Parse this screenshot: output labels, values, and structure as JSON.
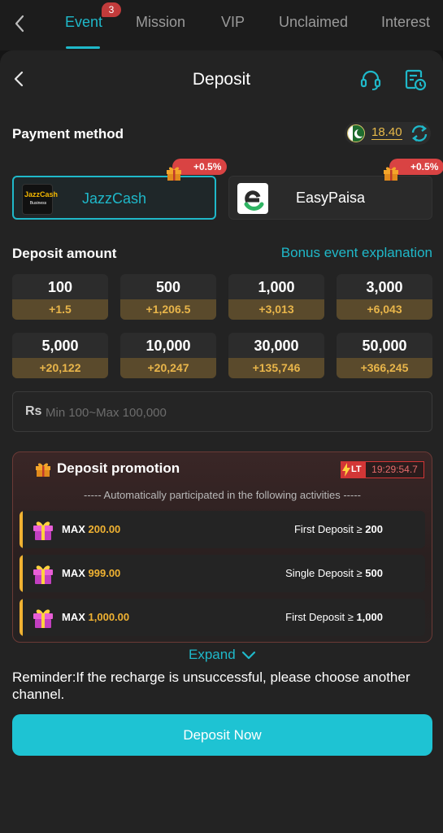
{
  "top_tabs": [
    {
      "label": "Event",
      "active": true,
      "badge": "3"
    },
    {
      "label": "Mission",
      "active": false
    },
    {
      "label": "VIP",
      "active": false
    },
    {
      "label": "Unclaimed",
      "active": false
    },
    {
      "label": "Interest",
      "active": false
    }
  ],
  "header": {
    "title": "Deposit",
    "icons": [
      "back-icon",
      "customer-service-icon",
      "deposit-history-icon"
    ]
  },
  "payment": {
    "label": "Payment method",
    "balance": "18.40",
    "balance_flag": "pakistan-flag-icon",
    "methods": [
      {
        "name": "JazzCash",
        "logo_text": "JazzCash",
        "logo_sub": "Business",
        "bonus": "+0.5%",
        "selected": true
      },
      {
        "name": "EasyPaisa",
        "bonus": "+0.5%",
        "selected": false
      }
    ]
  },
  "deposit_amount": {
    "label": "Deposit amount",
    "link": "Bonus event explanation",
    "options": [
      {
        "amount": "100",
        "bonus": "+1.5"
      },
      {
        "amount": "500",
        "bonus": "+1,206.5"
      },
      {
        "amount": "1,000",
        "bonus": "+3,013"
      },
      {
        "amount": "3,000",
        "bonus": "+6,043"
      },
      {
        "amount": "5,000",
        "bonus": "+20,122"
      },
      {
        "amount": "10,000",
        "bonus": "+20,247"
      },
      {
        "amount": "30,000",
        "bonus": "+135,746"
      },
      {
        "amount": "50,000",
        "bonus": "+366,245"
      }
    ],
    "currency": "Rs",
    "placeholder": "Min 100~Max 100,000"
  },
  "promotion": {
    "title": "Deposit promotion",
    "timer_tag": "LT",
    "timer": "19:29:54.7",
    "note": "----- Automatically participated in the following activities -----",
    "items": [
      {
        "max_label": "MAX",
        "max_value": "200.00",
        "condition": "First Deposit ≥ ",
        "threshold": "200"
      },
      {
        "max_label": "MAX",
        "max_value": "999.00",
        "condition": "Single Deposit ≥ ",
        "threshold": "500"
      },
      {
        "max_label": "MAX",
        "max_value": "1,000.00",
        "condition": "First Deposit ≥ ",
        "threshold": "1,000"
      }
    ],
    "expand": "Expand"
  },
  "reminder": "Reminder:If the recharge is unsuccessful, please choose another channel.",
  "submit": "Deposit Now",
  "colors": {
    "accent": "#1fb8c9",
    "gold": "#e8b54a",
    "badge_red": "#d94343"
  }
}
